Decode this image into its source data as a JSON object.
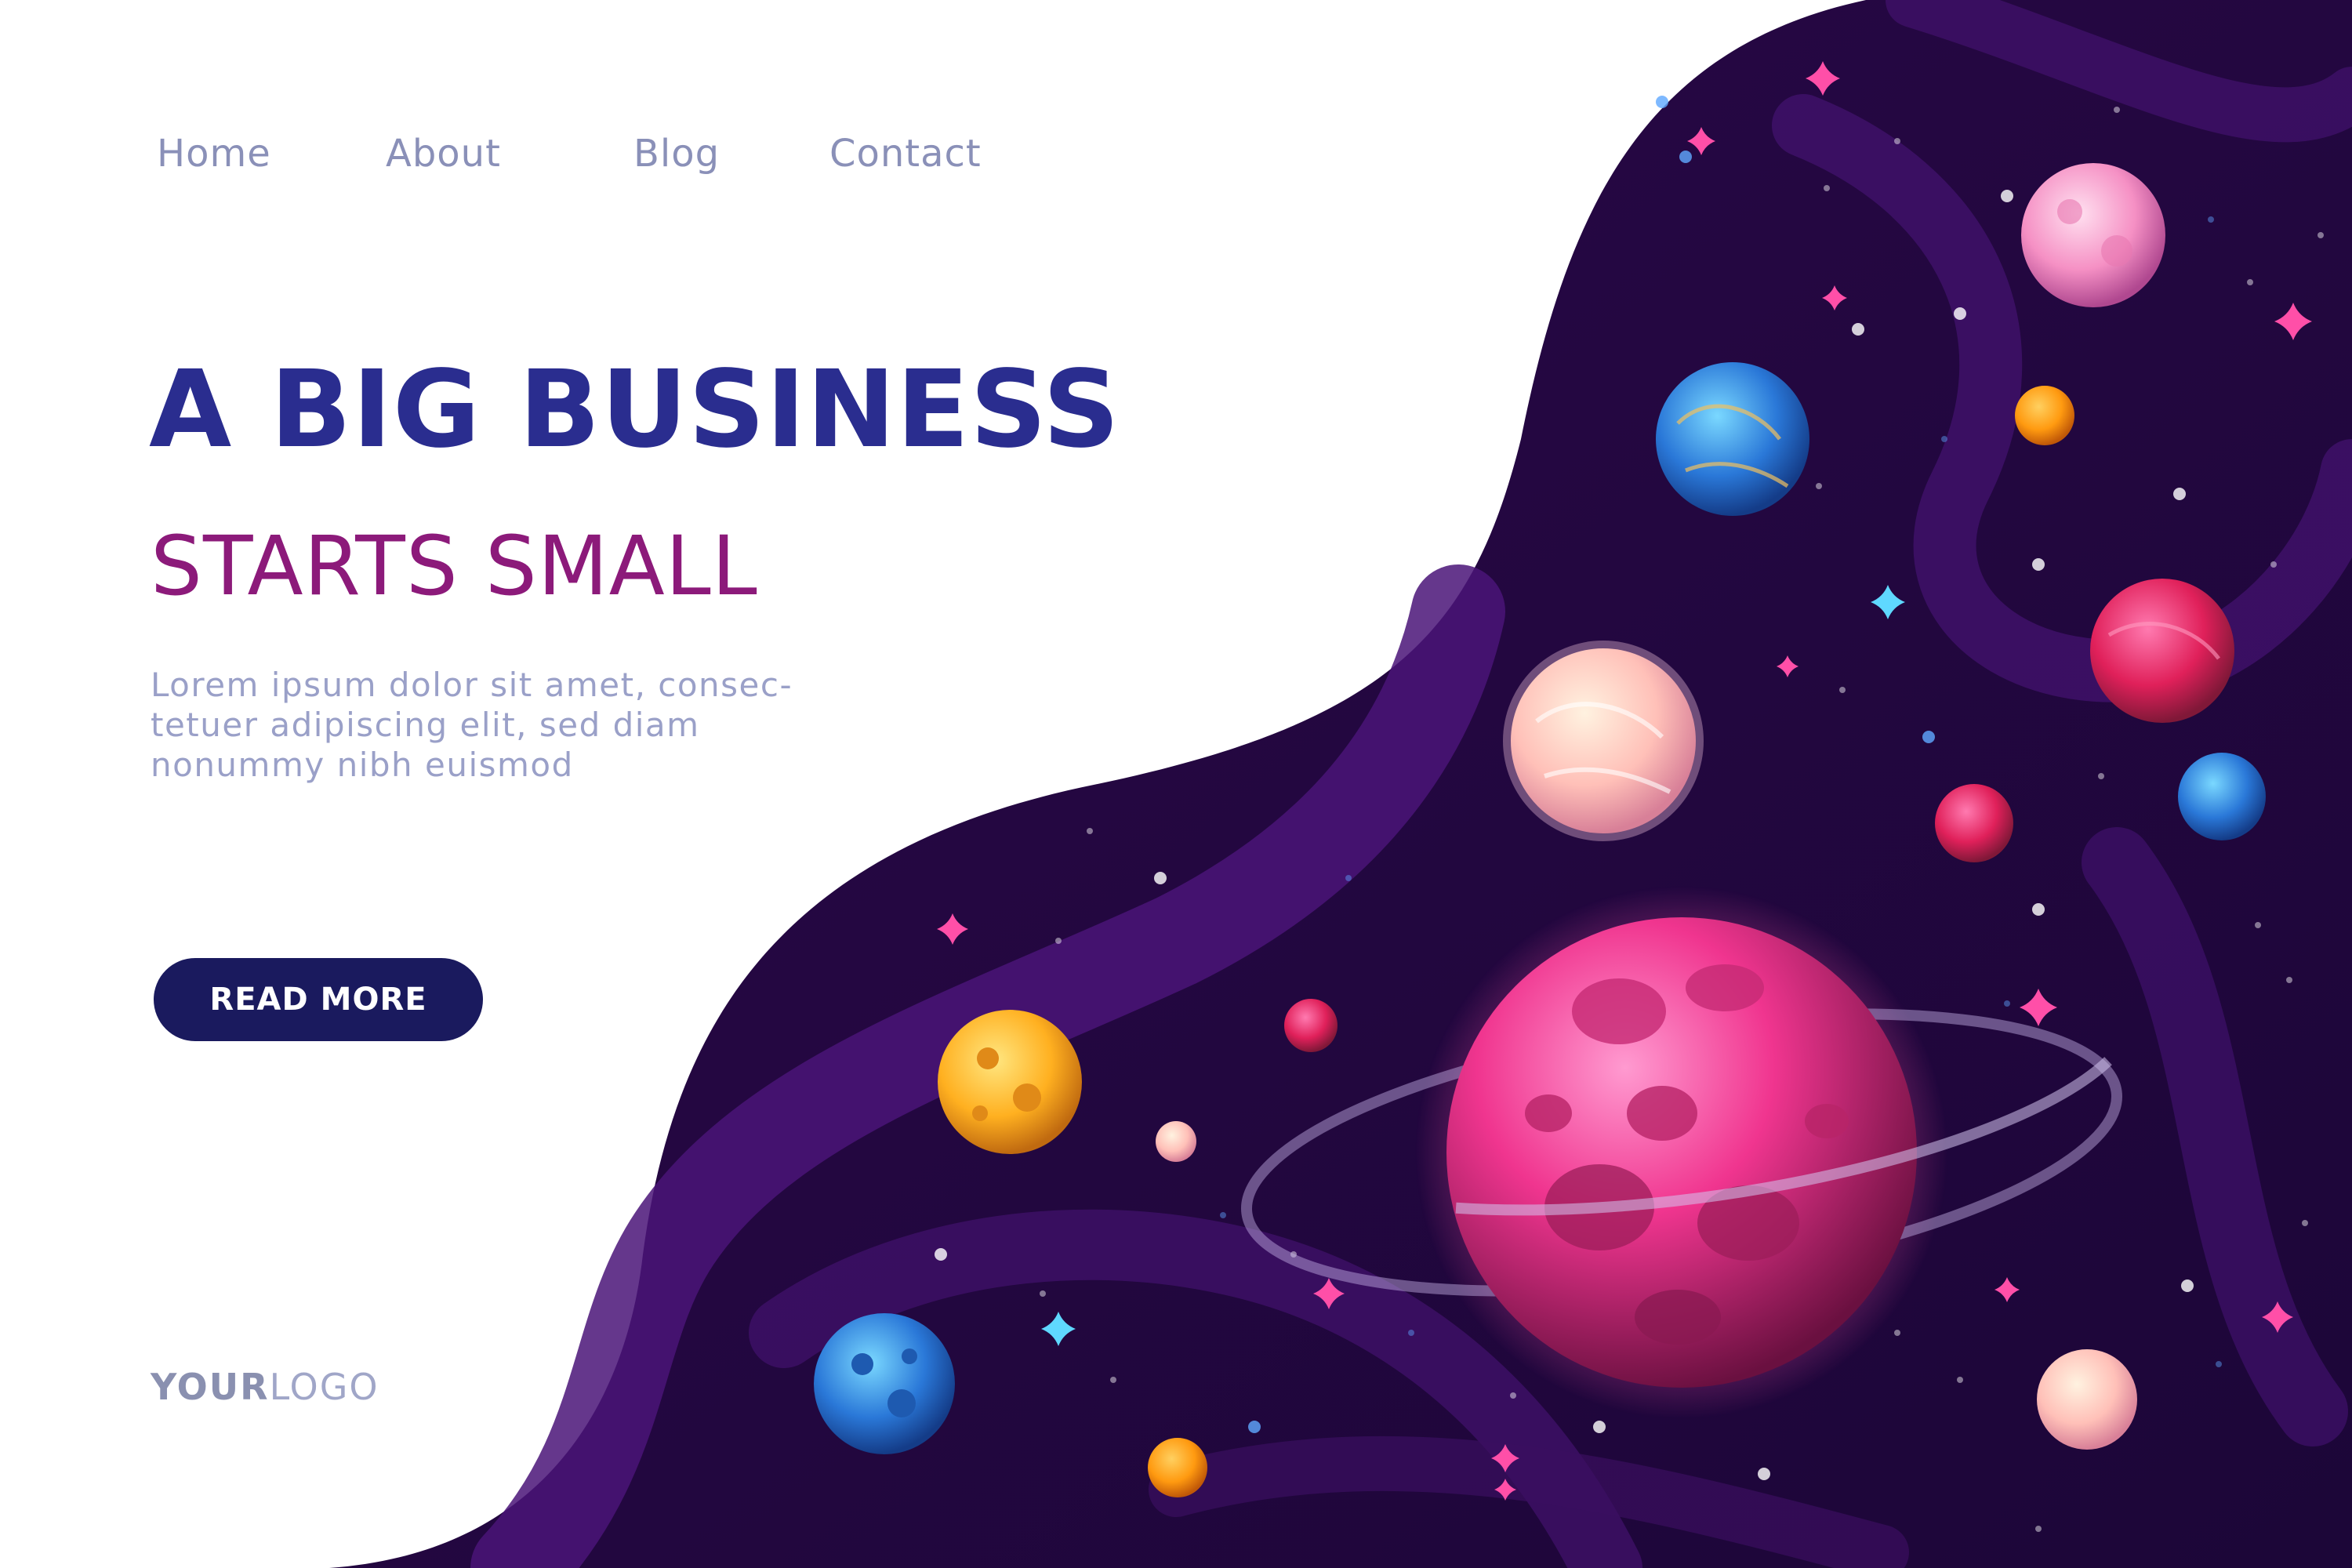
{
  "nav": {
    "items": [
      "Home",
      "About",
      "Blog",
      "Contact"
    ]
  },
  "hero": {
    "title": "A BIG BUSINESS",
    "subtitle": "STARTS SMALL",
    "description_lines": [
      "Lorem ipsum dolor sit amet, consec-",
      "tetuer adipiscing elit, sed diam",
      "nonummy nibh euismod"
    ],
    "cta_label": "READ MORE"
  },
  "logo": {
    "bold_part": "YOUR",
    "light_part": "LOGO"
  },
  "colors": {
    "title": "#2a2d8f",
    "subtitle": "#8c1a7a",
    "nav_text": "#8a90b8",
    "body_text": "#9aa0c8",
    "button_bg": "#1a1a5e",
    "space_dark": "#2a0a4a",
    "space_light": "#5a1a8a"
  },
  "illustration": {
    "planets": [
      {
        "name": "pink-ringed-planet",
        "icon": "ringed-planet-icon"
      },
      {
        "name": "light-pink-planet",
        "icon": "planet-icon"
      },
      {
        "name": "blue-swirl-planet",
        "icon": "planet-icon"
      },
      {
        "name": "orange-small-planet",
        "icon": "planet-icon"
      },
      {
        "name": "magenta-swirl-planet",
        "icon": "planet-icon"
      },
      {
        "name": "cream-swirl-planet",
        "icon": "planet-icon"
      },
      {
        "name": "magenta-small-planet",
        "icon": "planet-icon"
      },
      {
        "name": "blue-crater-planet-small",
        "icon": "planet-icon"
      },
      {
        "name": "yellow-crater-planet",
        "icon": "planet-icon"
      },
      {
        "name": "tiny-pink-moon",
        "icon": "planet-icon"
      },
      {
        "name": "tiny-cream-moon",
        "icon": "planet-icon"
      },
      {
        "name": "blue-crater-planet",
        "icon": "planet-icon"
      },
      {
        "name": "orange-tiny-planet",
        "icon": "planet-icon"
      },
      {
        "name": "pale-pink-planet",
        "icon": "planet-icon"
      }
    ]
  }
}
